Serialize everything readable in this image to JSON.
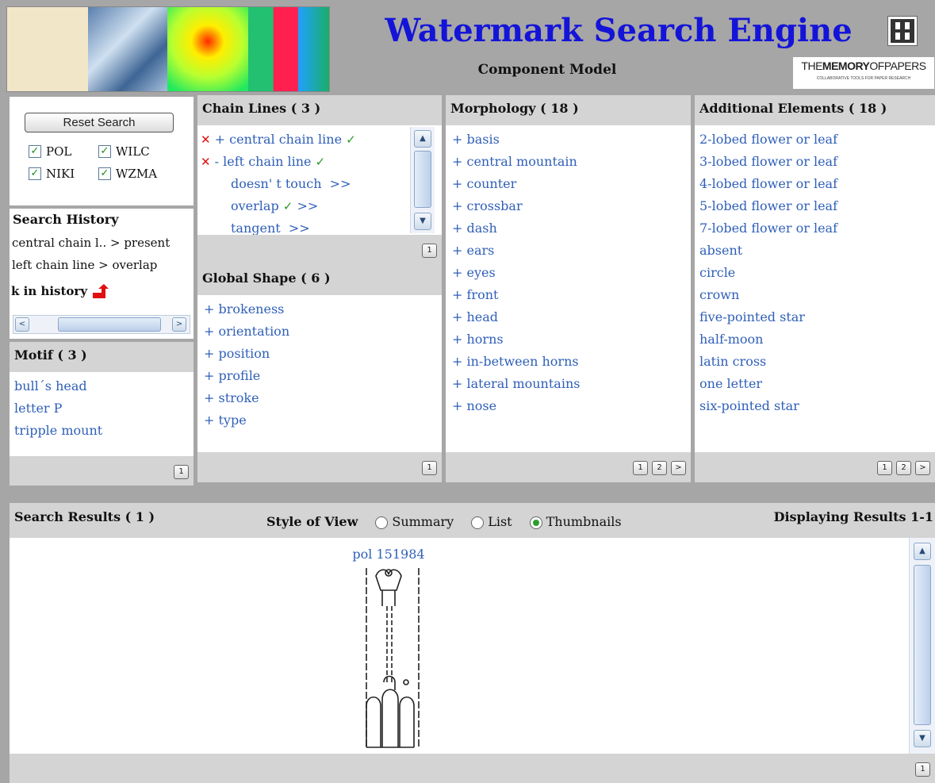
{
  "header": {
    "title": "Watermark Search Engine",
    "subtitle": "Component Model",
    "logo_text_thin": "THE",
    "logo_text_bold": "MEMORY",
    "logo_text_thin2": "OFPAPERS",
    "logo_tagline": "COLLABORATIVE TOOLS FOR PAPER RESEARCH"
  },
  "search": {
    "reset_label": "Reset Search",
    "databases": [
      {
        "label": "POL",
        "checked": true
      },
      {
        "label": "WILC",
        "checked": true
      },
      {
        "label": "NIKI",
        "checked": true
      },
      {
        "label": "WZMA",
        "checked": true
      }
    ]
  },
  "history": {
    "title": "Search History",
    "items": [
      "central chain l.. > present",
      "left chain line > overlap"
    ],
    "back_label": "k in history"
  },
  "motif": {
    "title": "Motif",
    "count": "( 3 )",
    "items": [
      "bull´s head",
      "letter P",
      "tripple mount"
    ],
    "pages": [
      "1"
    ]
  },
  "chain_lines": {
    "title": "Chain Lines",
    "count": "( 3 )",
    "items": [
      {
        "label": "+ central chain line",
        "x": true,
        "tick": true
      },
      {
        "label": "- left chain line",
        "x": true,
        "tick": true
      },
      {
        "label": "doesn' t touch",
        "suffix": ">>"
      },
      {
        "label": "overlap",
        "tick": true,
        "suffix": ">>"
      },
      {
        "label": "tangent",
        "suffix": ">>"
      }
    ],
    "pages": [
      "1"
    ]
  },
  "global_shape": {
    "title": "Global Shape",
    "count": "( 6 )",
    "items": [
      "+ brokeness",
      "+ orientation",
      "+ position",
      "+ profile",
      "+ stroke",
      "+ type"
    ],
    "pages": [
      "1"
    ]
  },
  "morphology": {
    "title": "Morphology",
    "count": "( 18 )",
    "items": [
      "+ basis",
      "+ central mountain",
      "+ counter",
      "+ crossbar",
      "+ dash",
      "+ ears",
      "+ eyes",
      "+ front",
      "+ head",
      "+ horns",
      "+ in-between horns",
      "+ lateral mountains",
      "+ nose"
    ],
    "pages": [
      "1",
      "2",
      ">"
    ]
  },
  "additional": {
    "title": "Additional Elements",
    "count": "( 18 )",
    "items": [
      "2-lobed flower or leaf",
      "3-lobed flower or leaf",
      "4-lobed flower or leaf",
      "5-lobed flower or leaf",
      "7-lobed flower or leaf",
      "absent",
      "circle",
      "crown",
      "five-pointed star",
      "half-moon",
      "latin cross",
      "one letter",
      "six-pointed star"
    ],
    "pages": [
      "1",
      "2",
      ">"
    ]
  },
  "results": {
    "title": "Search Results",
    "count": "( 1 )",
    "style_label": "Style of View",
    "views": [
      {
        "label": "Summary",
        "selected": false
      },
      {
        "label": "List",
        "selected": false
      },
      {
        "label": "Thumbnails",
        "selected": true
      }
    ],
    "displaying": "Displaying Results 1-1",
    "items": [
      {
        "id": "pol 151984"
      }
    ],
    "pages": [
      "1"
    ]
  },
  "colors": {
    "background": "#a6a6a6",
    "title_blue": "#1414d8",
    "link_blue": "#2f5fb8",
    "panel_header": "#d4d4d4",
    "check_green": "#2a9a2a",
    "x_red": "#dd1111"
  },
  "icons": [
    "checkbox-checked-icon",
    "remove-x-icon",
    "check-icon",
    "back-arrow-icon",
    "scroll-up-icon",
    "scroll-down-icon",
    "scroll-left-icon",
    "scroll-right-icon",
    "radio-icon",
    "logo-grid-icon"
  ]
}
